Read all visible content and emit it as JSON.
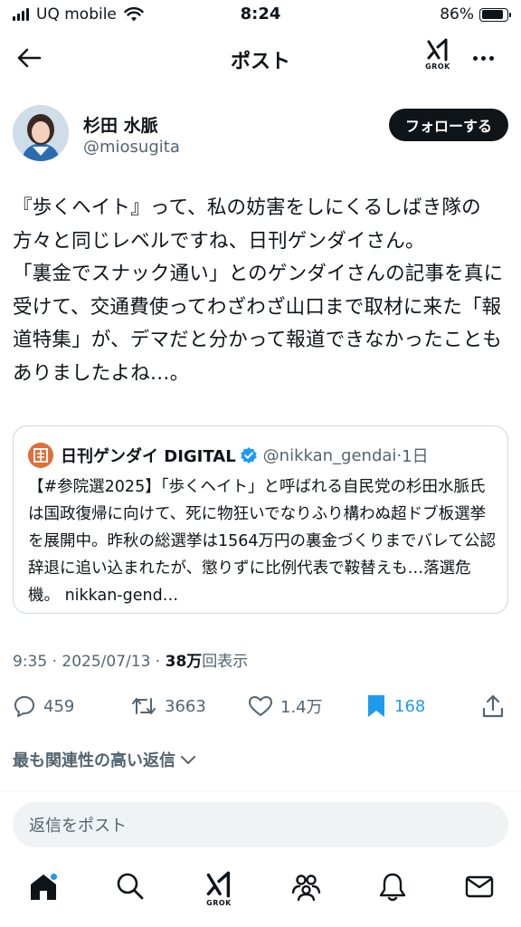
{
  "status_bar": {
    "carrier": "UQ mobile",
    "time": "8:24",
    "battery_percent": "86%",
    "battery_level": 0.86,
    "signal_bars": 4
  },
  "nav": {
    "title": "ポスト",
    "grok_label": "GROK"
  },
  "author": {
    "name": "杉田 水脈",
    "handle": "@miosugita",
    "follow_label": "フォローする"
  },
  "post": {
    "text": "『歩くヘイト』って、私の妨害をしにくるしばき隊の方々と同じレベルですね、日刊ゲンダイさん。\n「裏金でスナック通い」とのゲンダイさんの記事を真に受けて、交通費使ってわざわざ山口まで取材に来た「報道特集」が、デマだと分かって報道できなかったこともありましたよね…。"
  },
  "quote": {
    "name": "日刊ゲンダイ DIGITAL",
    "handle": "@nikkan_gendai",
    "separator": "·",
    "time": "1日",
    "text": "【#参院選2025】「歩くヘイト」と呼ばれる自民党の杉田水脈氏は国政復帰に向けて、死に物狂いでなりふり構わぬ超ドブ板選挙を展開中。昨秋の総選挙は1564万円の裏金づくりまでバレて公認辞退に追い込まれたが、懲りずに比例代表で鞍替えも…落選危機。 nikkan-gend…"
  },
  "meta": {
    "time": "9:35",
    "separator1": " · ",
    "date": "2025/07/13",
    "separator2": " · ",
    "views_count": "38万",
    "views_label": "回表示"
  },
  "actions": {
    "replies": "459",
    "reposts": "3663",
    "likes": "1.4万",
    "bookmarks": "168"
  },
  "replies_sort": {
    "label": "最も関連性の高い返信"
  },
  "reply_box": {
    "placeholder": "返信をポスト"
  },
  "tabs": {
    "grok_label": "GROK"
  },
  "colors": {
    "text": "#0f1419",
    "secondary": "#536471",
    "accent": "#1d9bf0",
    "border": "#cfd9de"
  }
}
